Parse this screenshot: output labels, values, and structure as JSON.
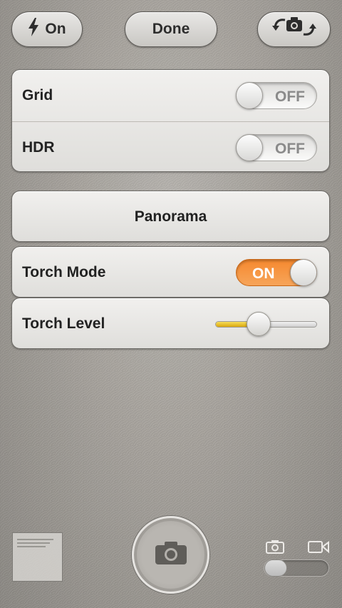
{
  "top_bar": {
    "flash_label": "On",
    "done_label": "Done"
  },
  "settings": {
    "grid_label": "Grid",
    "grid_state": "OFF",
    "hdr_label": "HDR",
    "hdr_state": "OFF"
  },
  "panorama_label": "Panorama",
  "torch_mode": {
    "label": "Torch Mode",
    "state": "ON"
  },
  "torch_level": {
    "label": "Torch Level",
    "value": 0.4
  },
  "bottom_bar": {
    "camera_mode": "photo"
  },
  "colors": {
    "accent_on": "#f5892f",
    "slider_fill": "#e8c22a"
  },
  "icons": [
    "bolt-icon",
    "camera-flip-icon",
    "camera-icon",
    "video-camera-icon"
  ]
}
